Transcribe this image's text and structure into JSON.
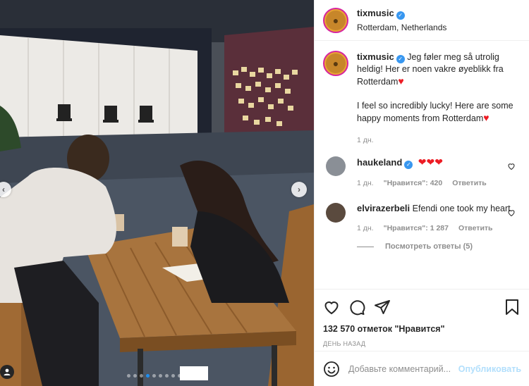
{
  "post": {
    "author": {
      "username": "tixmusic",
      "location": "Rotterdam, Netherlands",
      "verified": true
    },
    "caption": {
      "username": "tixmusic",
      "text_no": "Jeg føler meg så utrolig heldig! Her er noen vakre øyeblikk fra Rotterdam",
      "text_en": "I feel so incredibly lucky! Here are some happy moments from Rotterdam",
      "heart": "♥",
      "time": "1 дн."
    },
    "comments": [
      {
        "username": "haukeland",
        "text": "❤❤❤",
        "time": "1 дн.",
        "likes": "\"Нравится\": 420",
        "reply": "Ответить",
        "avatar_color": "#8a8f96"
      },
      {
        "username": "elvirazerbeli",
        "text": "Efendi one took my heart",
        "time": "1 дн.",
        "likes": "\"Нравится\": 1 287",
        "reply": "Ответить",
        "avatar_color": "#5a4a3e",
        "view_replies": "Посмотреть ответы (5)"
      }
    ],
    "likes_count": "132 570 отметок \"Нравится\"",
    "time_ago": "ДЕНЬ НАЗАД",
    "add_comment": {
      "placeholder": "Добавьте комментарий...",
      "publish_label": "Опубликовать"
    },
    "carousel": {
      "total_slides": 10,
      "active_index": 3
    },
    "icons": {
      "like": "heart-outline-icon",
      "comment": "comment-bubble-icon",
      "share": "paper-plane-icon",
      "save": "bookmark-icon",
      "emoji": "smiley-icon",
      "tag": "person-tag-icon"
    },
    "colors": {
      "accent_blue": "#3897f0",
      "heart_red": "#ed1c24",
      "publish_disabled": "#b2dffc",
      "muted_text": "#8e8e8e"
    }
  }
}
